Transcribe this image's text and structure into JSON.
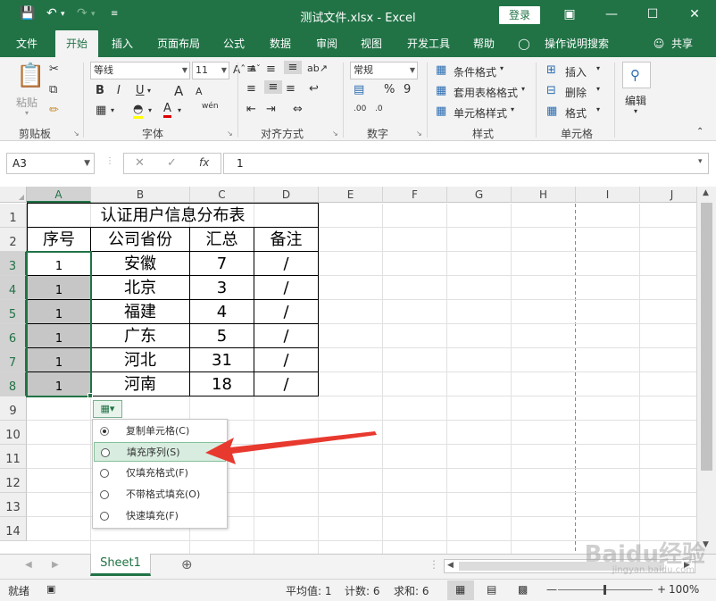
{
  "titlebar": {
    "title": "测试文件.xlsx  -  Excel",
    "login": "登录",
    "save_icon": "save-icon",
    "undo_icon": "undo-icon",
    "redo_icon": "redo-icon"
  },
  "tabs": [
    "文件",
    "开始",
    "插入",
    "页面布局",
    "公式",
    "数据",
    "审阅",
    "视图",
    "开发工具",
    "帮助",
    "操作说明搜索",
    "共享"
  ],
  "ribbon": {
    "clipboard": {
      "label": "剪贴板",
      "paste": "粘贴"
    },
    "font": {
      "label": "字体",
      "name": "等线",
      "size": "11",
      "bold": "B",
      "italic": "I",
      "underline": "U",
      "grow": "A",
      "shrink": "A"
    },
    "alignment": {
      "label": "对齐方式"
    },
    "number": {
      "label": "数字",
      "format": "常规",
      "percent": "%",
      "comma": "9"
    },
    "styles": {
      "label": "样式",
      "conditional": "条件格式",
      "table": "套用表格格式",
      "cell": "单元格样式"
    },
    "cells": {
      "label": "单元格",
      "insert": "插入",
      "delete": "删除",
      "format": "格式"
    },
    "editing": {
      "label": "编辑"
    }
  },
  "formula_bar": {
    "name_box": "A3",
    "fx": "fx",
    "content": "1"
  },
  "columns": [
    "A",
    "B",
    "C",
    "D",
    "E",
    "F",
    "G",
    "H",
    "I",
    "J"
  ],
  "rows": [
    "1",
    "2",
    "3",
    "4",
    "5",
    "6",
    "7",
    "8",
    "9",
    "10",
    "11",
    "12",
    "13",
    "14"
  ],
  "table": {
    "title": "认证用户信息分布表",
    "headers": [
      "序号",
      "公司省份",
      "汇总",
      "备注"
    ],
    "rows": [
      [
        "1",
        "安徽",
        "7",
        "/"
      ],
      [
        "1",
        "北京",
        "3",
        "/"
      ],
      [
        "1",
        "福建",
        "4",
        "/"
      ],
      [
        "1",
        "广东",
        "5",
        "/"
      ],
      [
        "1",
        "河北",
        "31",
        "/"
      ],
      [
        "1",
        "河南",
        "18",
        "/"
      ]
    ]
  },
  "autofill_menu": [
    {
      "label": "复制单元格(C)",
      "selected": true
    },
    {
      "label": "填充序列(S)",
      "selected": false
    },
    {
      "label": "仅填充格式(F)",
      "selected": false
    },
    {
      "label": "不带格式填充(O)",
      "selected": false
    },
    {
      "label": "快速填充(F)",
      "selected": false
    }
  ],
  "sheet_tab": "Sheet1",
  "status": {
    "mode": "就绪",
    "average": "平均值: 1",
    "count": "计数: 6",
    "sum": "求和: 6",
    "zoom": "100%"
  },
  "watermark": {
    "main": "Baidu经验",
    "sub": "jingyan.baidu.com"
  },
  "colors": {
    "accent": "#217346",
    "arrow": "#e8392f"
  }
}
